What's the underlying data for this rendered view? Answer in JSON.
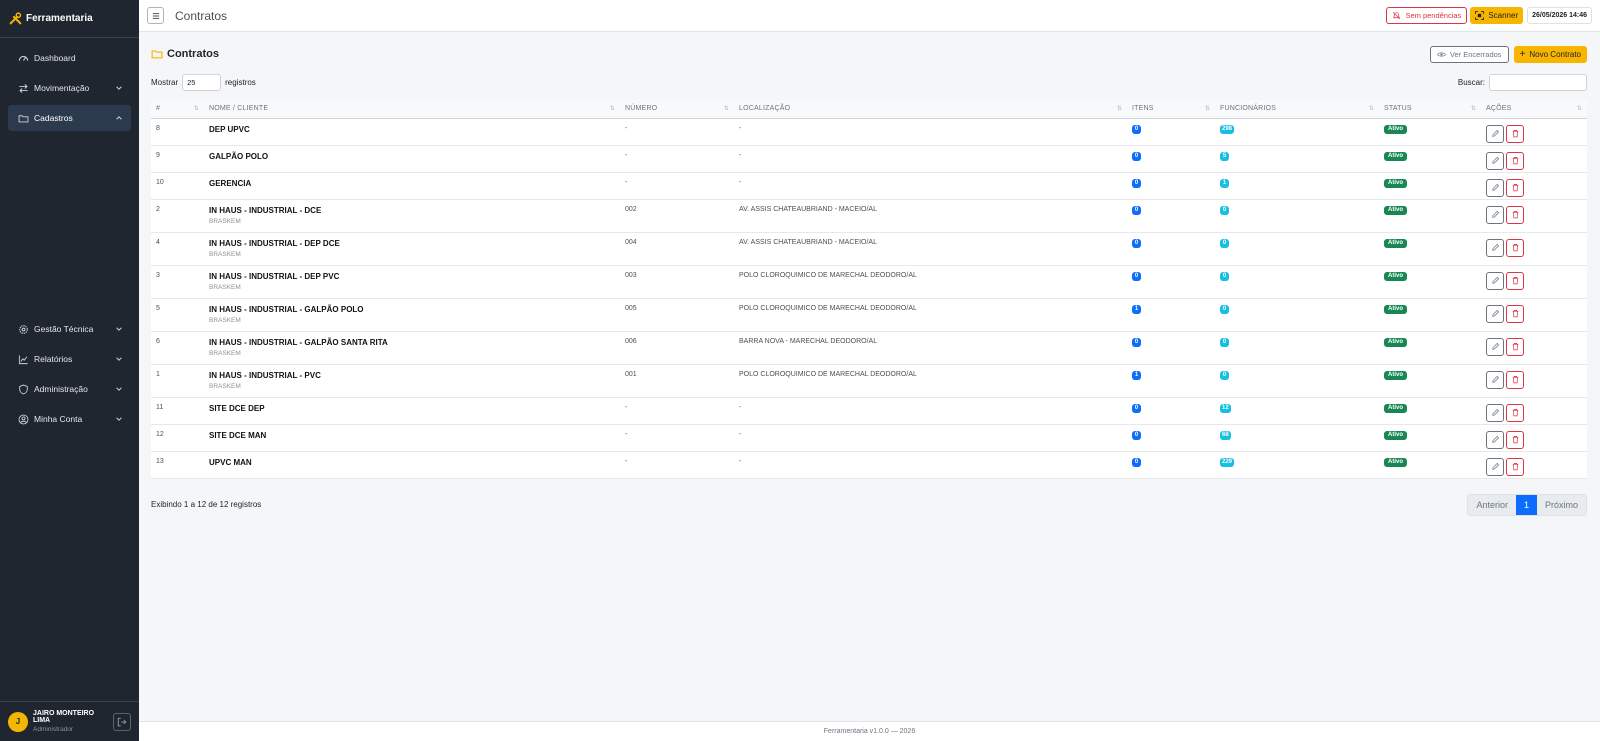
{
  "brand": {
    "name": "Ferramentaria",
    "accent": "#f7b500"
  },
  "sidebar": {
    "items": [
      {
        "label": "Dashboard",
        "icon": "dashboard-icon"
      },
      {
        "label": "Movimentação",
        "icon": "arrows-icon"
      },
      {
        "label": "Cadastros",
        "icon": "folder-icon",
        "active": true
      }
    ],
    "lower_items": [
      {
        "label": "Gestão Técnica",
        "icon": "gear-icon"
      },
      {
        "label": "Relatórios",
        "icon": "chart-icon"
      },
      {
        "label": "Administração",
        "icon": "shield-icon"
      },
      {
        "label": "Minha Conta",
        "icon": "user-circle-icon"
      }
    ],
    "user": {
      "initial": "J",
      "name": "JAIRO MONTEIRO LIMA",
      "role": "Administrador"
    }
  },
  "topbar": {
    "title": "Contratos",
    "pending_label": "Sem pendências",
    "scanner_label": "Scanner",
    "datetime": "26/05/2026 14:46"
  },
  "main": {
    "heading": "Contratos",
    "closed_button": "Ver Encerrados",
    "new_button": "Novo Contrato",
    "show_label": "Mostrar",
    "show_value": "25",
    "records_label": "registros",
    "search_label": "Buscar:",
    "search_value": "",
    "columns": [
      "#",
      "NOME / CLIENTE",
      "NÚMERO",
      "LOCALIZAÇÃO",
      "ITENS",
      "FUNCIONÁRIOS",
      "STATUS",
      "AÇÕES"
    ],
    "rows": [
      {
        "id": "8",
        "name": "DEP UPVC",
        "client": "",
        "number": "-",
        "location": "-",
        "items": "0",
        "employees": "298",
        "status": "Ativo"
      },
      {
        "id": "9",
        "name": "GALPÃO POLO",
        "client": "",
        "number": "-",
        "location": "-",
        "items": "0",
        "employees": "5",
        "status": "Ativo"
      },
      {
        "id": "10",
        "name": "GERENCIA",
        "client": "",
        "number": "-",
        "location": "-",
        "items": "0",
        "employees": "1",
        "status": "Ativo"
      },
      {
        "id": "2",
        "name": "IN HAUS - INDUSTRIAL - DCE",
        "client": "BRASKEM",
        "number": "002",
        "location": "AV. ASSIS CHATEAUBRIAND - MACEIO/AL",
        "items": "0",
        "employees": "0",
        "status": "Ativo"
      },
      {
        "id": "4",
        "name": "IN HAUS - INDUSTRIAL - DEP DCE",
        "client": "BRASKEM",
        "number": "004",
        "location": "AV. ASSIS CHATEAUBRIAND - MACEIO/AL",
        "items": "0",
        "employees": "0",
        "status": "Ativo"
      },
      {
        "id": "3",
        "name": "IN HAUS - INDUSTRIAL - DEP PVC",
        "client": "BRASKEM",
        "number": "003",
        "location": "POLO CLOROQUIMICO DE MARECHAL DEODORO/AL",
        "items": "0",
        "employees": "0",
        "status": "Ativo"
      },
      {
        "id": "5",
        "name": "IN HAUS - INDUSTRIAL - GALPÃO POLO",
        "client": "BRASKEM",
        "number": "005",
        "location": "POLO CLOROQUIMICO DE MARECHAL DEODORO/AL",
        "items": "1",
        "employees": "0",
        "status": "Ativo"
      },
      {
        "id": "6",
        "name": "IN HAUS - INDUSTRIAL - GALPÃO SANTA RITA",
        "client": "BRASKEM",
        "number": "006",
        "location": "BARRA NOVA - MARECHAL DEODORO/AL",
        "items": "0",
        "employees": "0",
        "status": "Ativo"
      },
      {
        "id": "1",
        "name": "IN HAUS - INDUSTRIAL - PVC",
        "client": "BRASKEM",
        "number": "001",
        "location": "POLO CLOROQUIMICO DE MARECHAL DEODORO/AL",
        "items": "1",
        "employees": "0",
        "status": "Ativo"
      },
      {
        "id": "11",
        "name": "SITE DCE DEP",
        "client": "",
        "number": "-",
        "location": "-",
        "items": "0",
        "employees": "12",
        "status": "Ativo"
      },
      {
        "id": "12",
        "name": "SITE DCE MAN",
        "client": "",
        "number": "-",
        "location": "-",
        "items": "0",
        "employees": "68",
        "status": "Ativo"
      },
      {
        "id": "13",
        "name": "UPVC MAN",
        "client": "",
        "number": "-",
        "location": "-",
        "items": "0",
        "employees": "229",
        "status": "Ativo"
      }
    ],
    "info_text": "Exibindo 1 a 12 de 12 registros",
    "pagination": {
      "prev": "Anterior",
      "current": "1",
      "next": "Próximo"
    }
  },
  "footer": {
    "text": "Ferramentaria v1.0.0 — 2026"
  }
}
